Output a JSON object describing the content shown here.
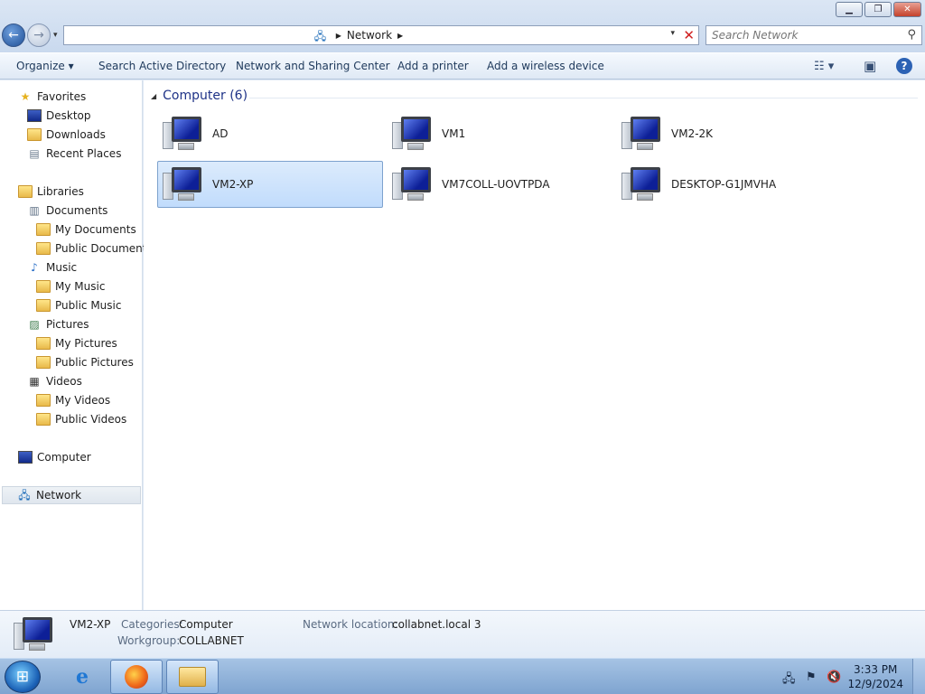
{
  "window": {
    "minimize": "▁",
    "maximize": "❐",
    "close": "✕"
  },
  "nav": {
    "back": "←",
    "forward": "→",
    "recent": "▾"
  },
  "address": {
    "path": "Network",
    "progress": 0.39,
    "dropdown": "▾",
    "stop": "✕"
  },
  "search": {
    "placeholder": "Search Network"
  },
  "toolbar": {
    "organize": "Organize ▾",
    "search_ad": "Search Active Directory",
    "network_sharing": "Network and Sharing Center",
    "add_printer": "Add a printer",
    "add_wireless": "Add a wireless device",
    "view_icon": "☷ ▾",
    "preview_icon": "▣",
    "help_icon": "?"
  },
  "sidebar": {
    "favorites": "Favorites",
    "desktop": "Desktop",
    "downloads": "Downloads",
    "recent_places": "Recent Places",
    "libraries": "Libraries",
    "documents": "Documents",
    "my_documents": "My Documents",
    "public_documents": "Public Documents",
    "music": "Music",
    "my_music": "My Music",
    "public_music": "Public Music",
    "pictures": "Pictures",
    "my_pictures": "My Pictures",
    "public_pictures": "Public Pictures",
    "videos": "Videos",
    "my_videos": "My Videos",
    "public_videos": "Public Videos",
    "computer": "Computer",
    "network": "Network"
  },
  "content": {
    "group_header": "Computer (6)",
    "items": [
      "AD",
      "VM1",
      "VM2-2K",
      "VM2-XP",
      "VM7COLL-UOVTPDA",
      "DESKTOP-G1JMVHA"
    ],
    "selected": "VM2-XP"
  },
  "details": {
    "name": "VM2-XP",
    "categories_label": "Categories:",
    "categories_value": "Computer",
    "workgroup_label": "Workgroup:",
    "workgroup_value": "COLLABNET",
    "location_label": "Network location:",
    "location_value": "collabnet.local 3"
  },
  "taskbar": {
    "start": "⊞",
    "ie": "e",
    "time": "3:33 PM",
    "date": "12/9/2024"
  },
  "colors": {
    "selection": "#c1dcfc",
    "group_header": "#1e3287",
    "taskbar": "#7fa4d0"
  }
}
